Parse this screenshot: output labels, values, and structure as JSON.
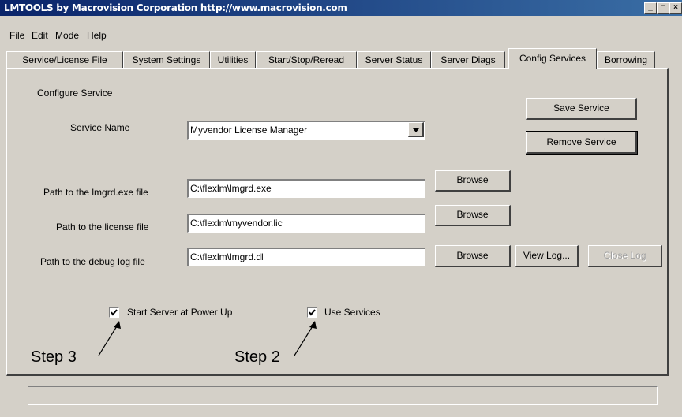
{
  "window": {
    "title": "LMTOOLS by Macrovision Corporation http://www.macrovision.com",
    "min_glyph": "_",
    "max_glyph": "□",
    "close_glyph": "×"
  },
  "menu": [
    "File",
    "Edit",
    "Mode",
    "Help"
  ],
  "tabs": [
    {
      "label": "Service/License File"
    },
    {
      "label": "System Settings"
    },
    {
      "label": "Utilities"
    },
    {
      "label": "Start/Stop/Reread"
    },
    {
      "label": "Server Status"
    },
    {
      "label": "Server Diags"
    },
    {
      "label": "Config Services",
      "active": true
    },
    {
      "label": "Borrowing"
    }
  ],
  "config": {
    "section_title": "Configure Service",
    "service_name_label": "Service Name",
    "service_name_value": "Myvendor License Manager",
    "save_service": "Save Service",
    "remove_service": "Remove Service",
    "lmgrd_label": "Path to the lmgrd.exe file",
    "lmgrd_value": "C:\\flexlm\\lmgrd.exe",
    "license_label": "Path to the license file",
    "license_value": "C:\\flexlm\\myvendor.lic",
    "debug_label": "Path to the debug log file",
    "debug_value": "C:\\flexlm\\lmgrd.dl",
    "browse": "Browse",
    "view_log": "View Log...",
    "close_log": "Close Log",
    "start_server_label": "Start Server at Power Up",
    "start_server_checked": true,
    "use_services_label": "Use Services",
    "use_services_checked": true
  },
  "annotations": {
    "step3": "Step 3",
    "step2": "Step 2"
  },
  "status": {
    "text": ""
  }
}
